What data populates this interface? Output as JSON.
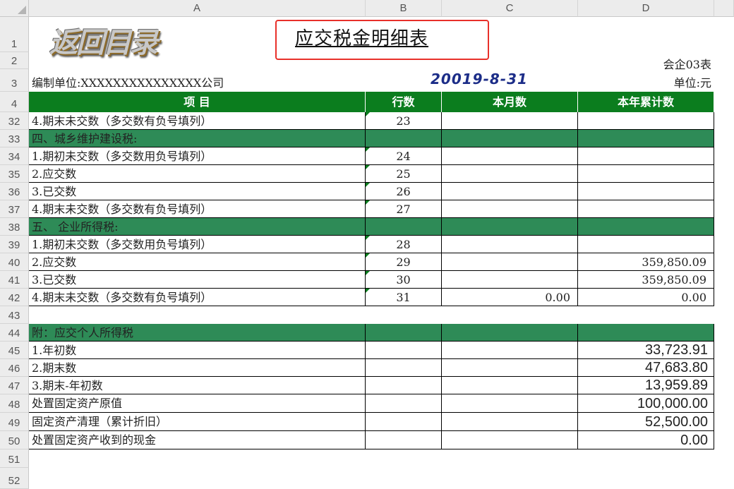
{
  "columns": [
    "A",
    "B",
    "C",
    "D"
  ],
  "logo_text": "返回目录",
  "title": "应交税金明细表",
  "form_code": "会企03表",
  "company": "编制单位:XXXXXXXXXXXXXXX公司",
  "date": "20019-8-31",
  "unit": "单位:元",
  "header": {
    "item": "项     目",
    "line": "行数",
    "month": "本月数",
    "year": "本年累计数"
  },
  "row_numbers": [
    "1",
    "2",
    "3",
    "4",
    "32",
    "33",
    "34",
    "35",
    "36",
    "37",
    "38",
    "39",
    "40",
    "41",
    "42",
    "43",
    "44",
    "45",
    "46",
    "47",
    "48",
    "49",
    "50",
    "51",
    "52"
  ],
  "rows": [
    {
      "row": "32",
      "item": "  4.期末未交数（多交数有负号填列）",
      "line": "23",
      "month": "",
      "year": ""
    },
    {
      "row": "33",
      "item": "四、城乡维护建设税:",
      "section": true
    },
    {
      "row": "34",
      "item": "  1.期初未交数（多交数用负号填列）",
      "line": "24",
      "month": "",
      "year": ""
    },
    {
      "row": "35",
      "item": "  2.应交数",
      "line": "25",
      "month": "",
      "year": ""
    },
    {
      "row": "36",
      "item": "  3.已交数",
      "line": "26",
      "month": "",
      "year": ""
    },
    {
      "row": "37",
      "item": "  4.期末未交数（多交数有负号填列）",
      "line": "27",
      "month": "",
      "year": ""
    },
    {
      "row": "38",
      "item": "五、 企业所得税:",
      "section": true
    },
    {
      "row": "39",
      "item": "  1.期初未交数（多交数用负号填列）",
      "line": "28",
      "month": "",
      "year": ""
    },
    {
      "row": "40",
      "item": "  2.应交数",
      "line": "29",
      "month": "",
      "year": "359,850.09"
    },
    {
      "row": "41",
      "item": "  3.已交数",
      "line": "30",
      "month": "",
      "year": "359,850.09"
    },
    {
      "row": "42",
      "item": "  4.期末未交数（多交数有负号填列）",
      "line": "31",
      "month": "0.00",
      "year": "0.00"
    }
  ],
  "appendix": [
    {
      "row": "44",
      "item": "附：应交个人所得税",
      "section": true
    },
    {
      "row": "45",
      "item": "      1.年初数",
      "year": "33,723.91"
    },
    {
      "row": "46",
      "item": "      2.期末数",
      "year": "47,683.80"
    },
    {
      "row": "47",
      "item": "      3.期末-年初数",
      "year": "13,959.89"
    },
    {
      "row": "48",
      "item": "处置固定资产原值",
      "year": "100,000.00"
    },
    {
      "row": "49",
      "item": "固定资产清理（累计折旧）",
      "year": "52,500.00"
    },
    {
      "row": "50",
      "item": "处置固定资产收到的现金",
      "year": "0.00"
    }
  ],
  "colors": {
    "header_green": "#0b7d1e",
    "section_green": "#2e8b57",
    "title_box": "#e8302a",
    "date_blue": "#1c2d88"
  }
}
